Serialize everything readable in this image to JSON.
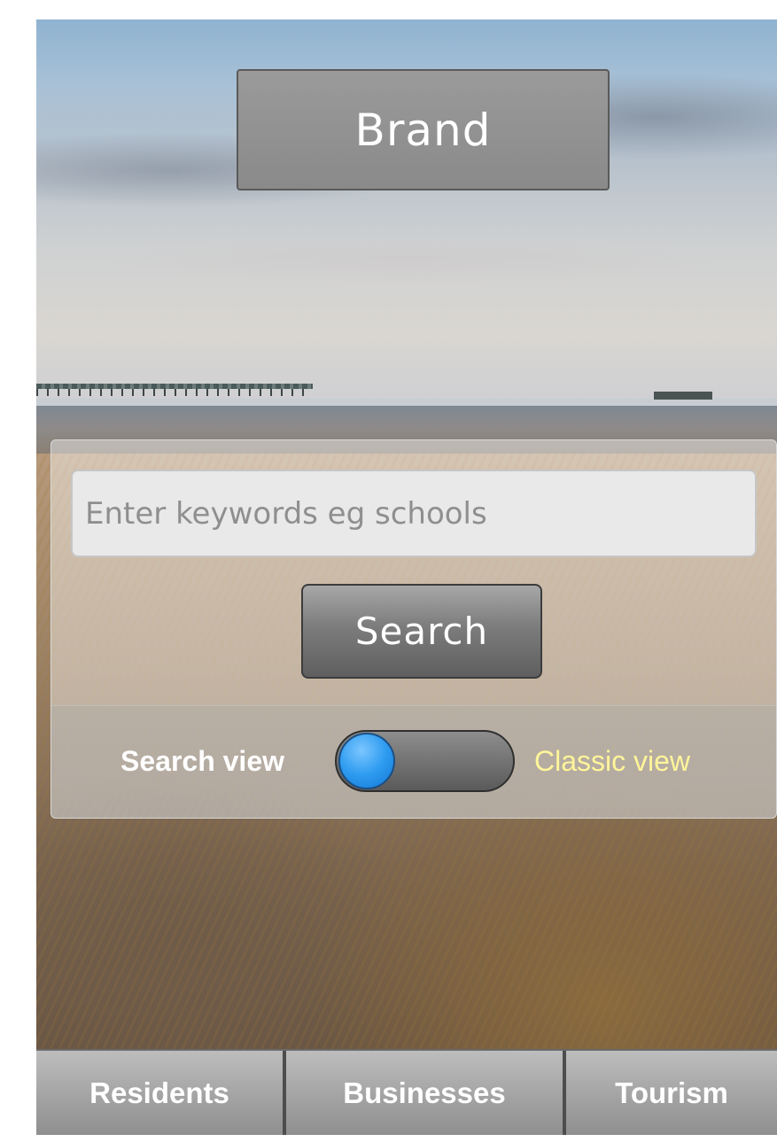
{
  "brand": {
    "label": "Brand"
  },
  "search": {
    "placeholder": "Enter keywords eg schools",
    "value": "",
    "button_label": "Search"
  },
  "view_toggle": {
    "left_label": "Search view",
    "right_label": "Classic view",
    "selected": "Search view",
    "knob_color": "#2e9cf0",
    "right_label_color": "#fff59a"
  },
  "tabs": [
    {
      "label": "Residents"
    },
    {
      "label": "Businesses"
    },
    {
      "label": "Tourism"
    }
  ]
}
